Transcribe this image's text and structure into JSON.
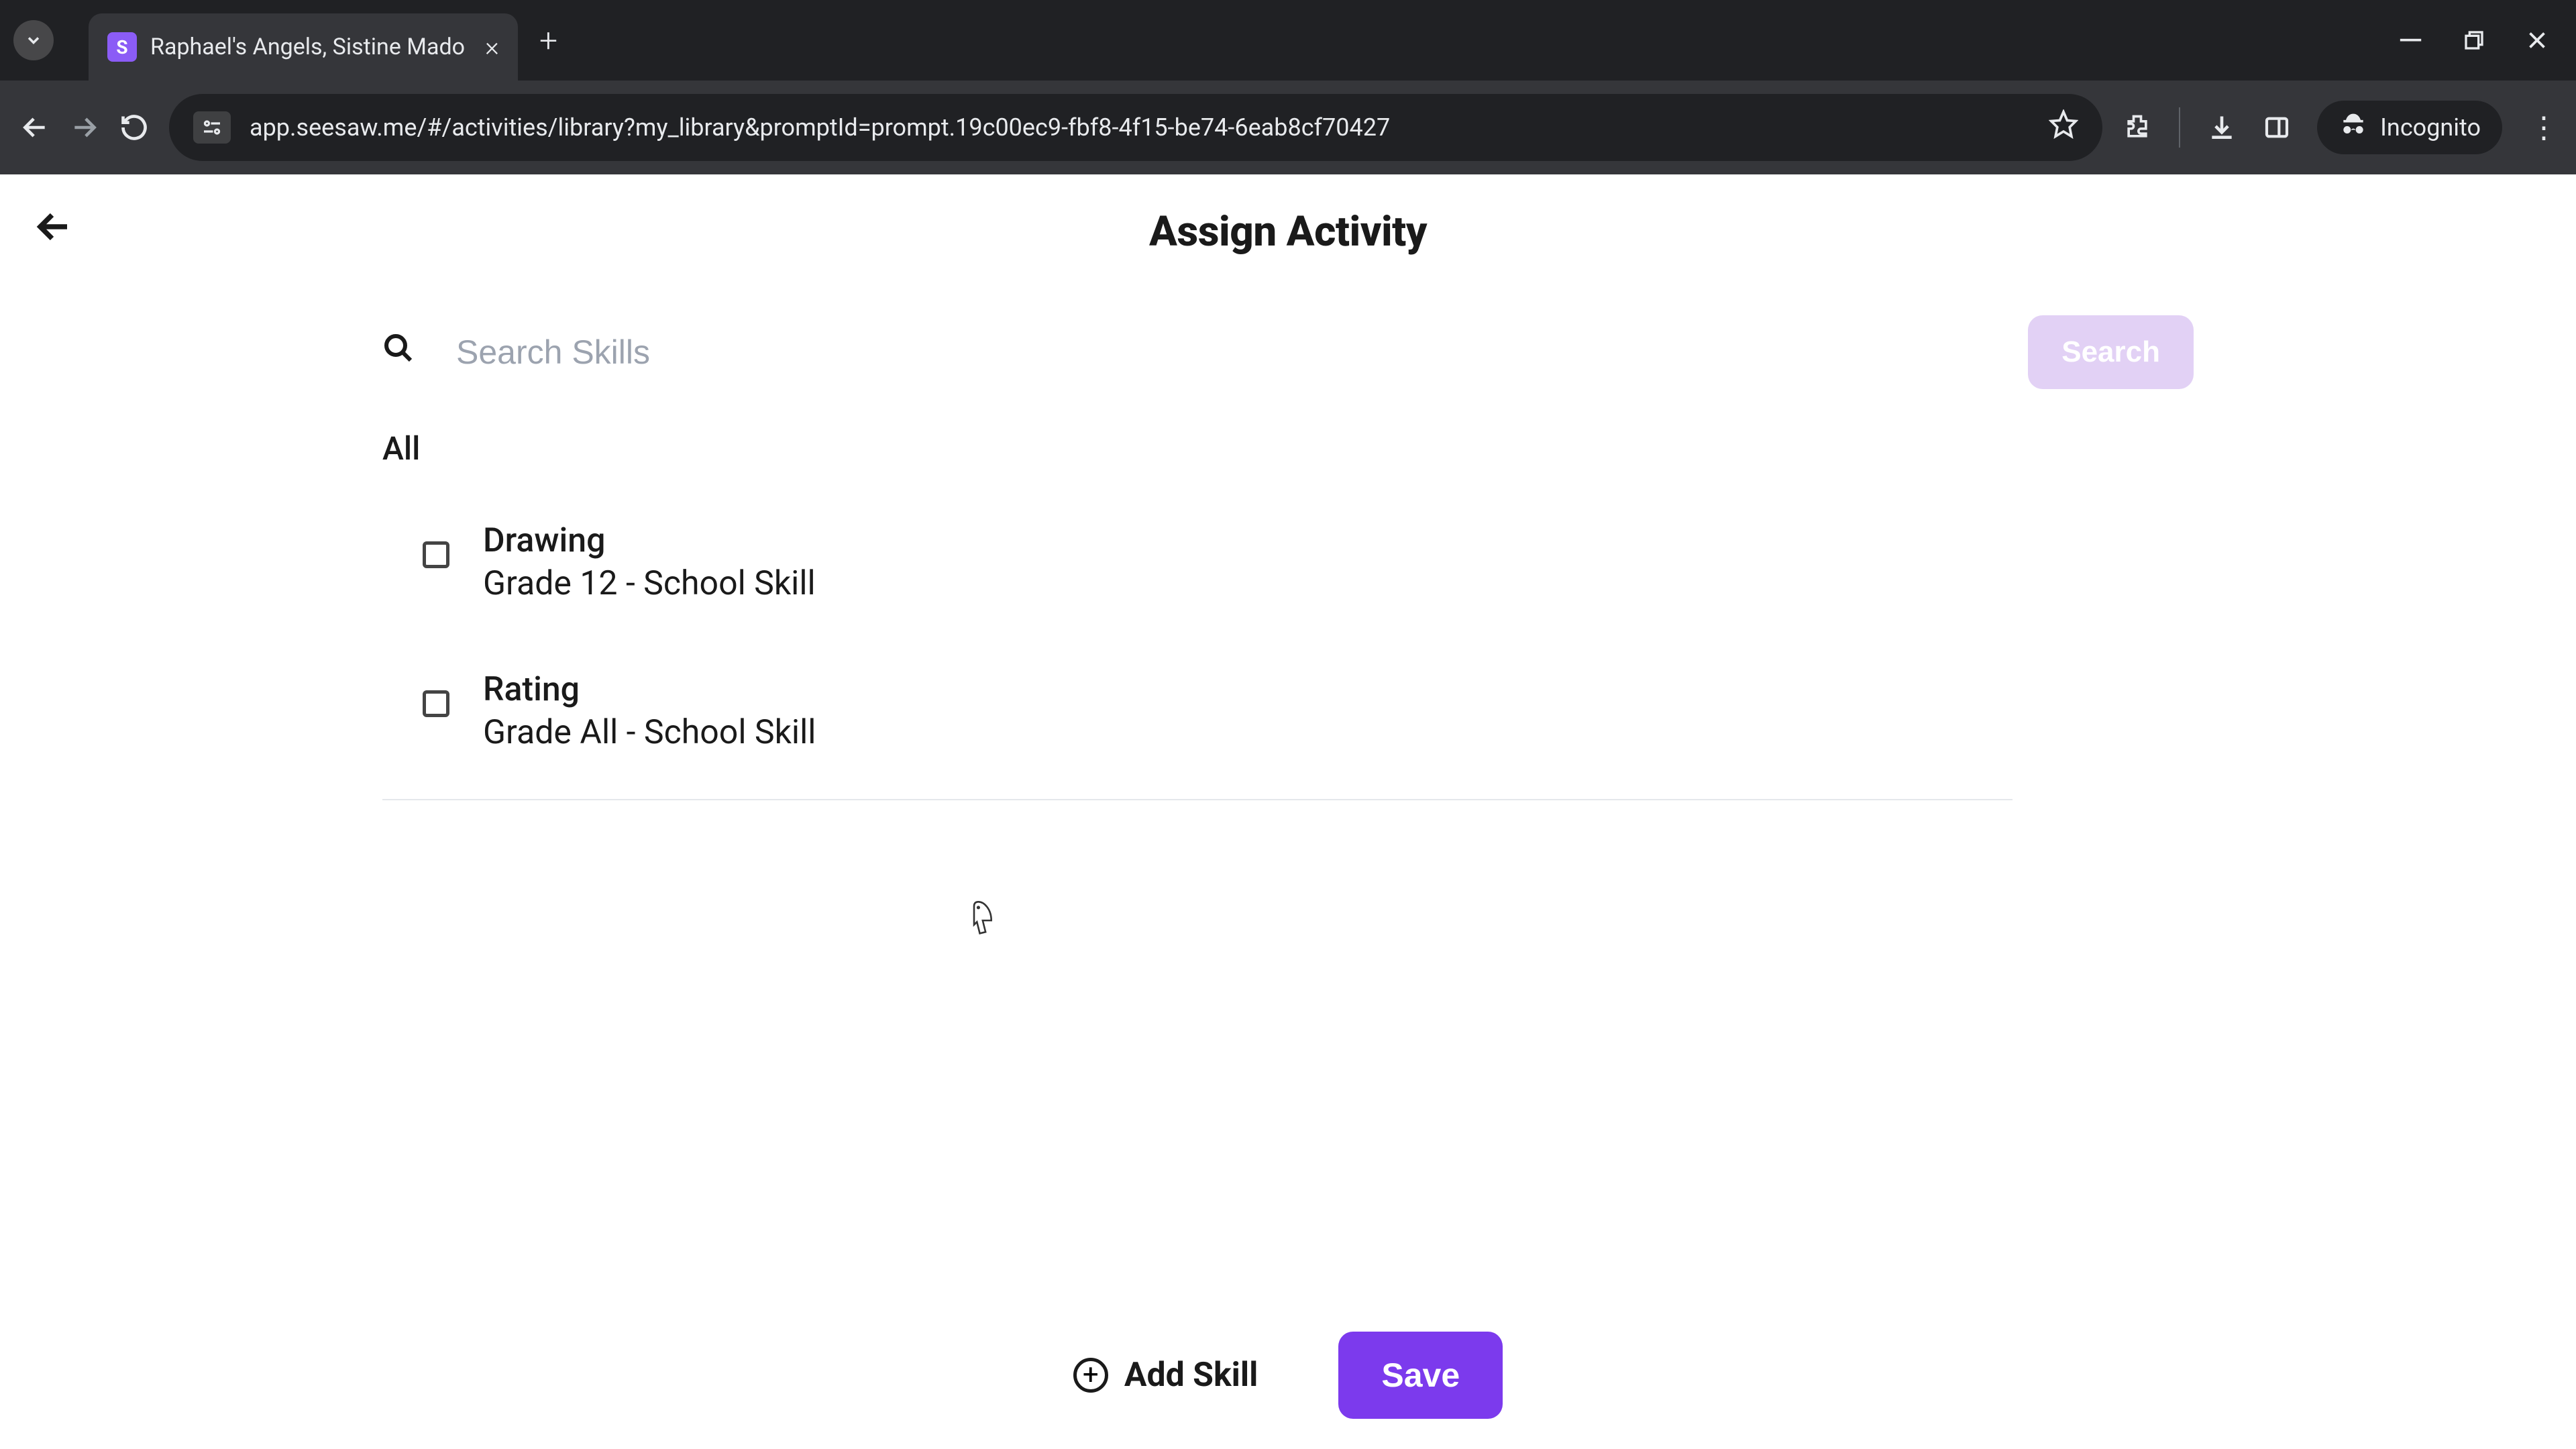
{
  "browser": {
    "tab": {
      "favicon_letter": "S",
      "title": "Raphael's Angels, Sistine Mado"
    },
    "url": "app.seesaw.me/#/activities/library?my_library&promptId=prompt.19c00ec9-fbf8-4f15-be74-6eab8cf70427",
    "incognito_label": "Incognito"
  },
  "page": {
    "title": "Assign Activity",
    "search": {
      "placeholder": "Search Skills",
      "button_label": "Search"
    },
    "filter_label": "All",
    "skills": [
      {
        "name": "Drawing",
        "grade": "Grade 12 - School Skill"
      },
      {
        "name": "Rating",
        "grade": "Grade All - School Skill"
      }
    ],
    "footer": {
      "add_skill_label": "Add Skill",
      "save_label": "Save"
    }
  },
  "colors": {
    "accent": "#7c3aed",
    "accent_light": "#e2d1f5"
  }
}
